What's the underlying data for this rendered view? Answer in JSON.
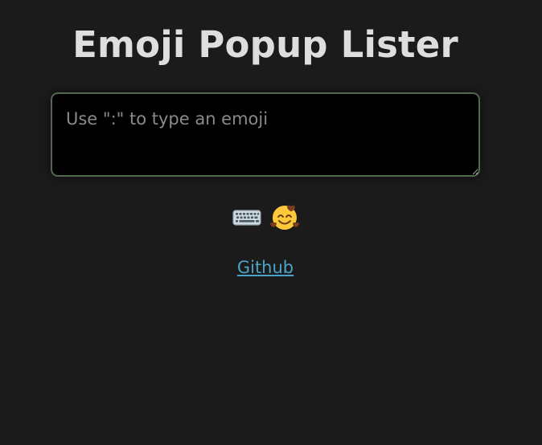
{
  "page": {
    "title": "Emoji Popup Lister",
    "background_color": "#1b1b1b"
  },
  "editor": {
    "value": "",
    "placeholder": "Use \":\" to type an emoji",
    "border_color": "#4f6a4c"
  },
  "icons": [
    {
      "name": "keyboard-icon"
    },
    {
      "name": "smiling-face-with-hearts-icon"
    }
  ],
  "footer": {
    "github_link_label": "Github",
    "link_color": "#4aa3c8"
  }
}
